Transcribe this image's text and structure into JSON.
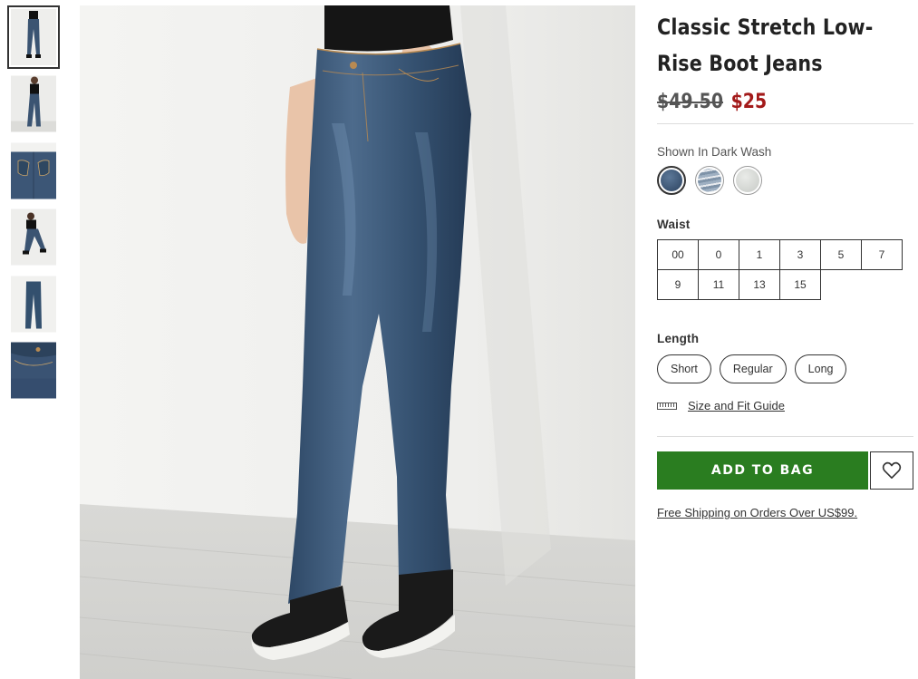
{
  "product": {
    "title": "Classic Stretch Low-Rise Boot Jeans",
    "price_original": "$49.50",
    "price_sale": "$25"
  },
  "color": {
    "label": "Shown In Dark Wash",
    "swatches": [
      {
        "name": "dark-wash",
        "color": "#3a4e66",
        "selected": true
      },
      {
        "name": "light-distressed-wash",
        "color": "#8fa2b5",
        "selected": false
      },
      {
        "name": "white-wash",
        "color": "#d7d9d6",
        "selected": false
      }
    ]
  },
  "waist": {
    "label": "Waist",
    "sizes": [
      "00",
      "0",
      "1",
      "3",
      "5",
      "7",
      "9",
      "11",
      "13",
      "15"
    ]
  },
  "length": {
    "label": "Length",
    "options": [
      "Short",
      "Regular",
      "Long"
    ]
  },
  "fit_guide": {
    "label": "Size and Fit Guide",
    "icon": "ruler-icon"
  },
  "actions": {
    "add_to_bag": "ADD TO BAG",
    "wishlist_icon": "heart-icon"
  },
  "shipping": {
    "text": "Free Shipping on Orders Over US$99."
  },
  "colors": {
    "accent_green": "#2a7d20",
    "sale_red": "#a31a1a"
  }
}
